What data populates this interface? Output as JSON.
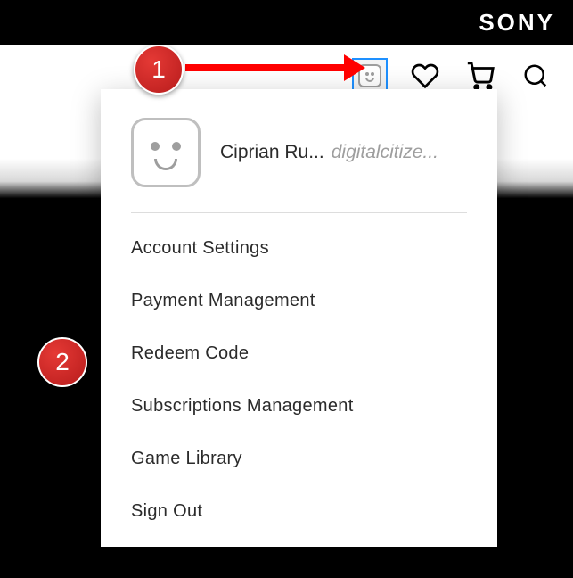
{
  "brand": "SONY",
  "user": {
    "display_name": "Ciprian Ru...",
    "handle": "digitalcitize..."
  },
  "menu": [
    {
      "label": "Account Settings",
      "id": "account-settings"
    },
    {
      "label": "Payment Management",
      "id": "payment-management"
    },
    {
      "label": "Redeem Code",
      "id": "redeem-code"
    },
    {
      "label": "Subscriptions Management",
      "id": "subscriptions-management"
    },
    {
      "label": "Game Library",
      "id": "game-library"
    },
    {
      "label": "Sign Out",
      "id": "sign-out"
    }
  ],
  "annotations": {
    "badge1": "1",
    "badge2": "2"
  }
}
